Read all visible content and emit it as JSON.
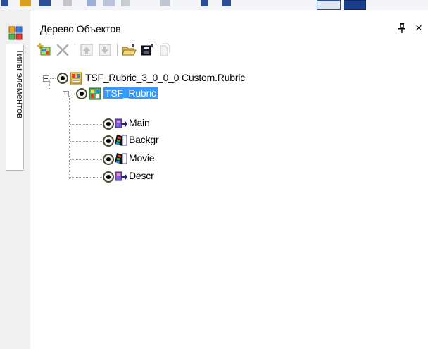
{
  "side_tab": {
    "label": "Типы элементов",
    "icon": "element-types-icon"
  },
  "panel": {
    "title": "Дерево Объектов",
    "pin_glyph": "ꟷ",
    "close_glyph": "×"
  },
  "toolbar": {
    "buttons": [
      "add-object-icon",
      "delete-icon",
      "move-up-icon",
      "move-down-icon",
      "open-folder-icon",
      "save-icon",
      "copy-icon"
    ]
  },
  "tree": {
    "root": {
      "label": "TSF_Rubric_3_0_0_0 Custom.Rubric",
      "icon": "rubric-template-icon"
    },
    "child": {
      "label": "TSF_Rubric",
      "icon": "rubric-icon",
      "selected": true
    },
    "leaves": [
      {
        "label": "Main",
        "icon": "page-arrow-icon"
      },
      {
        "label": "Backgr",
        "icon": "film-strip-icon"
      },
      {
        "label": "Movie",
        "icon": "film-strip-icon"
      },
      {
        "label": "Descr",
        "icon": "page-arrow-icon"
      }
    ]
  },
  "colors": {
    "selection": "#3399ff",
    "accent_blue": "#1f4fa8"
  }
}
